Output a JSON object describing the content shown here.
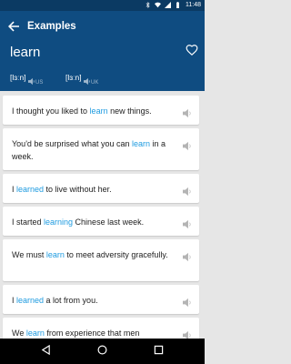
{
  "statusbar": {
    "time": "11:48"
  },
  "appbar": {
    "title": "Examples"
  },
  "word": {
    "text": "learn",
    "pronunciations": [
      {
        "ipa": "[lɜːn]",
        "region": "US"
      },
      {
        "ipa": "[lɜːn]",
        "region": "UK"
      }
    ]
  },
  "examples": [
    {
      "pre": "I thought you liked to ",
      "hl": "learn",
      "post": " new things."
    },
    {
      "pre": "You'd be surprised what you can ",
      "hl": "learn",
      "post": " in a week."
    },
    {
      "pre": "I ",
      "hl": "learned",
      "post": " to live without her."
    },
    {
      "pre": "I started ",
      "hl": "learning",
      "post": " Chinese last week."
    },
    {
      "pre": "We must ",
      "hl": "learn",
      "post": " to meet adversity gracefully."
    },
    {
      "pre": "I ",
      "hl": "learned",
      "post": " a lot from you."
    },
    {
      "pre": "We ",
      "hl": "learn",
      "post": " from experience that men"
    }
  ],
  "colors": {
    "appbar": "#0f4c81",
    "statusbar": "#0b3a63",
    "highlight": "#1e9be0"
  }
}
